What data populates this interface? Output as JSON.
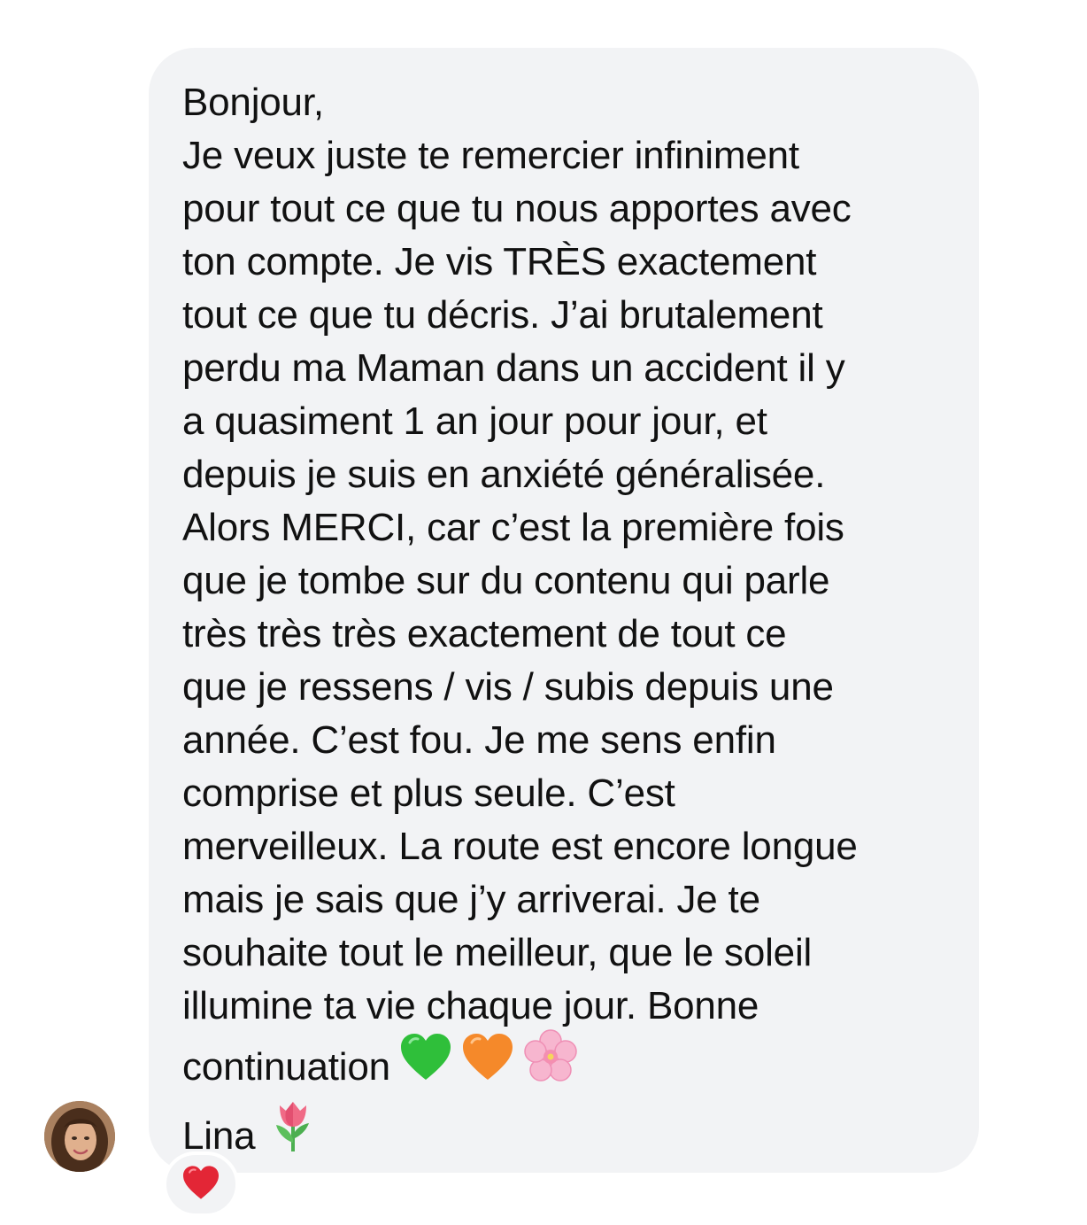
{
  "message": {
    "greeting": "Bonjour,",
    "lines": [
      "Je veux juste te remercier infiniment",
      "pour tout ce que tu nous apportes avec",
      "ton compte. Je vis TRÈS exactement",
      "tout ce que tu décris. J’ai brutalement",
      "perdu ma Maman dans un accident il y",
      "a quasiment 1 an jour pour jour, et",
      "depuis je suis en anxiété généralisée.",
      "Alors MERCI, car c’est la première fois",
      "que je tombe sur du contenu qui parle",
      "très très très exactement de tout ce",
      "que je ressens / vis / subis depuis une",
      "année. C’est fou. Je me sens enfin",
      "comprise et plus seule. C’est",
      "merveilleux. La route est encore longue",
      "mais je sais que j’y arriverai. Je te",
      "souhaite tout le meilleur, que le soleil",
      "illumine ta vie chaque jour. Bonne"
    ],
    "last_line": "continuation",
    "last_line_emojis": [
      "green-heart-emoji",
      "orange-heart-emoji",
      "cherry-blossom-emoji"
    ],
    "signature": "Lina",
    "signature_emoji": "tulip-emoji"
  },
  "reaction": {
    "emoji": "red-heart-emoji"
  },
  "colors": {
    "bubble": "#f2f3f5",
    "text": "#111111",
    "green_heart": "#2fbf3a",
    "orange_heart": "#f5892a",
    "blossom": "#f7b6cf",
    "tulip": "#f06a86",
    "red_heart": "#e32636"
  }
}
